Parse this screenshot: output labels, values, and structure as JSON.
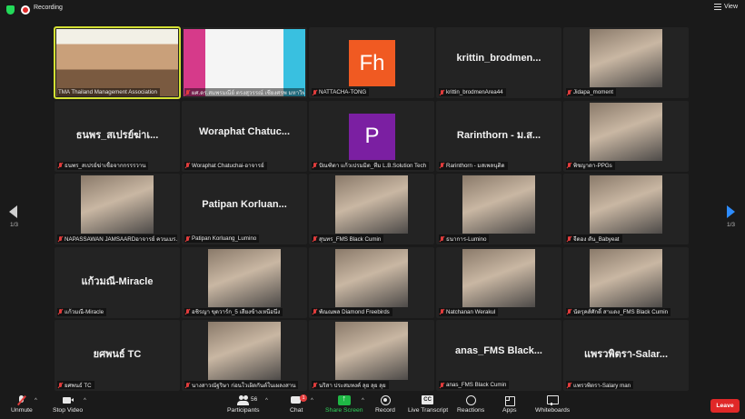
{
  "topbar": {
    "recording_label": "Recording",
    "view_label": "View"
  },
  "colors": {
    "background": "#1a1a1a",
    "tile_background": "#232323",
    "active_speaker_outline": "#d4e033",
    "muted_red": "#e23c3c",
    "share_green": "#1fb845",
    "nav_blue": "#2d8cff",
    "leave_red": "#e02828"
  },
  "grid": {
    "tiles": [
      {
        "caption": "TMA Thailand Management Association",
        "display": "video",
        "active": true,
        "muted": false
      },
      {
        "caption": "ผศ.ดร.สมพรมณีย์ ตรงสุวรรณ์ เชียงศรพ มหาวิทยา...",
        "display": "video",
        "muted": true
      },
      {
        "caption": "NATTACHA-TONG",
        "display": "avatar",
        "avatar_text": "Fh",
        "avatar_color": "#f05a22",
        "muted": true
      },
      {
        "caption": "krittin_brodmenArea44",
        "display": "name",
        "name": "krittin_brodmen...",
        "muted": true
      },
      {
        "caption": "Jidapa_moment",
        "display": "photo",
        "muted": true
      },
      {
        "caption": "ธนพร_สเปรย์ฆ่าเชื้อจากกรรรวาน",
        "display": "name",
        "name": "ธนพร_สเปรย์ฆ่าเ...",
        "muted": true
      },
      {
        "caption": "Woraphat Chatuchai-อาจารย์",
        "display": "name",
        "name": "Woraphat Chatuc...",
        "muted": true
      },
      {
        "caption": "ปัณฑิตา แก้วเปรมมิต_ทีม L.B.Solution Tech",
        "display": "avatar",
        "avatar_text": "P",
        "avatar_color": "#7b1fa2",
        "muted": true
      },
      {
        "caption": "Rarinthorn - มสเพลนุติด",
        "display": "name",
        "name": "Rarinthorn - ม.ส...",
        "muted": true
      },
      {
        "caption": "พิชญาดา-PPGs",
        "display": "photo",
        "muted": true
      },
      {
        "caption": "NAPASSAWAN JAMSAARDอาจารย์ ควนเมร...",
        "display": "photo",
        "muted": true
      },
      {
        "caption": "Patipan Korluang_Lumino",
        "display": "name",
        "name": "Patipan Korluan...",
        "muted": true
      },
      {
        "caption": "สุนทร_FMS Black Cumin",
        "display": "photo",
        "muted": true
      },
      {
        "caption": "ธนาการ-Lumino",
        "display": "photo",
        "muted": true
      },
      {
        "caption": "จีดอง ตัน_Babyeat",
        "display": "photo",
        "muted": true
      },
      {
        "caption": "แก้วมณี-Miracle",
        "display": "name",
        "name": "แก้วมณี-Miracle",
        "muted": true
      },
      {
        "caption": "อชิรญา ขุดวาร์ก_5 เสียงข้างเหนือนึ่ง",
        "display": "photo",
        "muted": true
      },
      {
        "caption": "พัณณพล Diamond Freebirds",
        "display": "photo",
        "muted": true
      },
      {
        "caption": "Natchanan Werakul",
        "display": "photo",
        "muted": true
      },
      {
        "caption": "นัตรุคส์ศักดิ์ สาแดง_FMS Black Cumin",
        "display": "photo",
        "muted": true
      },
      {
        "caption": "ยศพนธ์ TC",
        "display": "name",
        "name": "ยศพนธ์ TC",
        "muted": true
      },
      {
        "caption": "นางสาวณัฐริษา ก่อนใวเผิดกันต์ในเผลงสาน",
        "display": "photo",
        "muted": true
      },
      {
        "caption": "นริสา ประสมทงค์ ลุย ลุย ลุย",
        "display": "photo",
        "muted": true
      },
      {
        "caption": "anas_FMS Black Cumin",
        "display": "name",
        "name": "anas_FMS Black...",
        "muted": true
      },
      {
        "caption": "แพรวพิตรา-Salary man",
        "display": "name",
        "name": "แพรวพิตรา-Salar...",
        "muted": true
      }
    ]
  },
  "pagination": {
    "left": "1/3",
    "right": "1/3"
  },
  "toolbar": {
    "unmute": "Unmute",
    "stop_video": "Stop Video",
    "participants": "Participants",
    "participant_count": "56",
    "chat": "Chat",
    "chat_badge": "1",
    "share_screen": "Share Screen",
    "record": "Record",
    "live_transcript": "Live Transcript",
    "reactions": "Reactions",
    "apps": "Apps",
    "whiteboards": "Whiteboards",
    "leave": "Leave"
  }
}
